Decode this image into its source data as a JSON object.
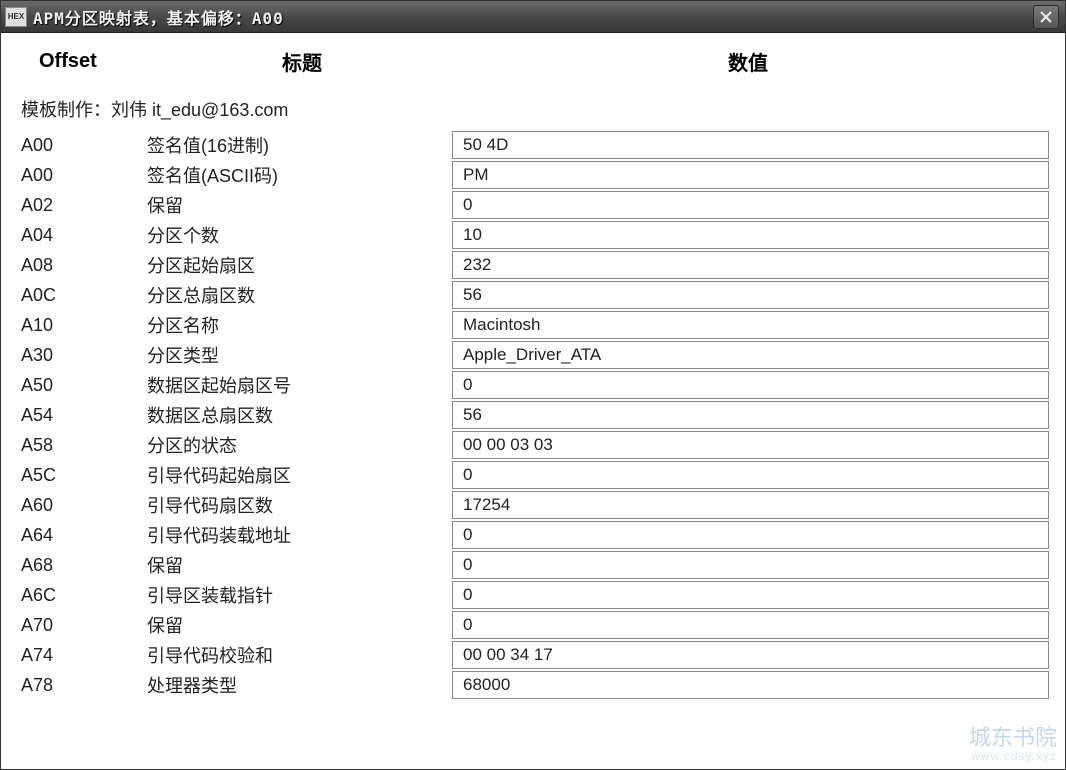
{
  "titlebar": {
    "icon_label": "HEX",
    "title": "APM分区映射表，基本偏移：A00"
  },
  "headers": {
    "offset": "Offset",
    "title": "标题",
    "value": "数值"
  },
  "author": "模板制作：刘伟  it_edu@163.com",
  "rows": [
    {
      "offset": "A00",
      "title": "签名值(16进制)",
      "value": "50 4D"
    },
    {
      "offset": "A00",
      "title": "签名值(ASCII码)",
      "value": "PM"
    },
    {
      "offset": "A02",
      "title": "保留",
      "value": "0"
    },
    {
      "offset": "A04",
      "title": "分区个数",
      "value": "10"
    },
    {
      "offset": "A08",
      "title": "分区起始扇区",
      "value": "232"
    },
    {
      "offset": "A0C",
      "title": "分区总扇区数",
      "value": "56"
    },
    {
      "offset": "A10",
      "title": "分区名称",
      "value": "Macintosh"
    },
    {
      "offset": "A30",
      "title": "分区类型",
      "value": "Apple_Driver_ATA"
    },
    {
      "offset": "A50",
      "title": "数据区起始扇区号",
      "value": "0"
    },
    {
      "offset": "A54",
      "title": "数据区总扇区数",
      "value": "56"
    },
    {
      "offset": "A58",
      "title": "分区的状态",
      "value": "00 00 03 03"
    },
    {
      "offset": "A5C",
      "title": "引导代码起始扇区",
      "value": "0"
    },
    {
      "offset": "A60",
      "title": "引导代码扇区数",
      "value": "17254"
    },
    {
      "offset": "A64",
      "title": "引导代码装载地址",
      "value": "0"
    },
    {
      "offset": "A68",
      "title": "保留",
      "value": "0"
    },
    {
      "offset": "A6C",
      "title": "引导区装载指针",
      "value": "0"
    },
    {
      "offset": "A70",
      "title": "保留",
      "value": "0"
    },
    {
      "offset": "A74",
      "title": "引导代码校验和",
      "value": "00 00 34 17"
    },
    {
      "offset": "A78",
      "title": "处理器类型",
      "value": "68000"
    }
  ],
  "watermark": {
    "main": "城东书院",
    "sub": "www.cdsy.xyz"
  }
}
